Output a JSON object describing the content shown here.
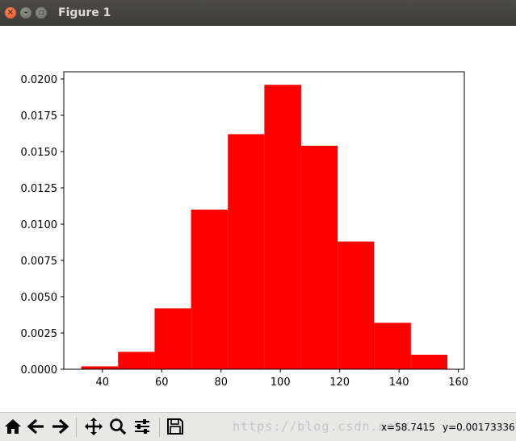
{
  "window": {
    "title": "Figure 1"
  },
  "toolbar": {
    "buttons": [
      {
        "icon": "home-icon"
      },
      {
        "icon": "back-arrow-icon"
      },
      {
        "icon": "forward-arrow-icon"
      },
      {
        "icon": "pan-icon"
      },
      {
        "icon": "zoom-icon"
      },
      {
        "icon": "subplots-config-icon"
      },
      {
        "icon": "save-icon"
      }
    ],
    "watermark": "https://blog.csdn.net/...",
    "x_readout": "x=58.7415",
    "y_readout": "y=0.00173336"
  },
  "chart_data": {
    "type": "bar",
    "bar_color": "#ff0000",
    "grid": false,
    "xlim": [
      27,
      162
    ],
    "ylim": [
      0,
      0.0205
    ],
    "x_ticks": [
      40,
      60,
      80,
      100,
      120,
      140,
      160
    ],
    "x_tick_labels": [
      "40",
      "60",
      "80",
      "100",
      "120",
      "140",
      "160"
    ],
    "y_ticks": [
      0,
      0.0025,
      0.005,
      0.0075,
      0.01,
      0.0125,
      0.015,
      0.0175,
      0.02
    ],
    "y_tick_labels": [
      "0.0000",
      "0.0025",
      "0.0050",
      "0.0075",
      "0.0100",
      "0.0125",
      "0.0150",
      "0.0175",
      "0.0200"
    ],
    "bins": [
      32.9,
      45.3,
      57.6,
      69.9,
      82.3,
      94.6,
      107.0,
      119.3,
      131.6,
      144.0,
      156.3
    ],
    "values": [
      0.0002,
      0.0012,
      0.0042,
      0.011,
      0.0162,
      0.0196,
      0.0154,
      0.0088,
      0.0032,
      0.001
    ]
  }
}
